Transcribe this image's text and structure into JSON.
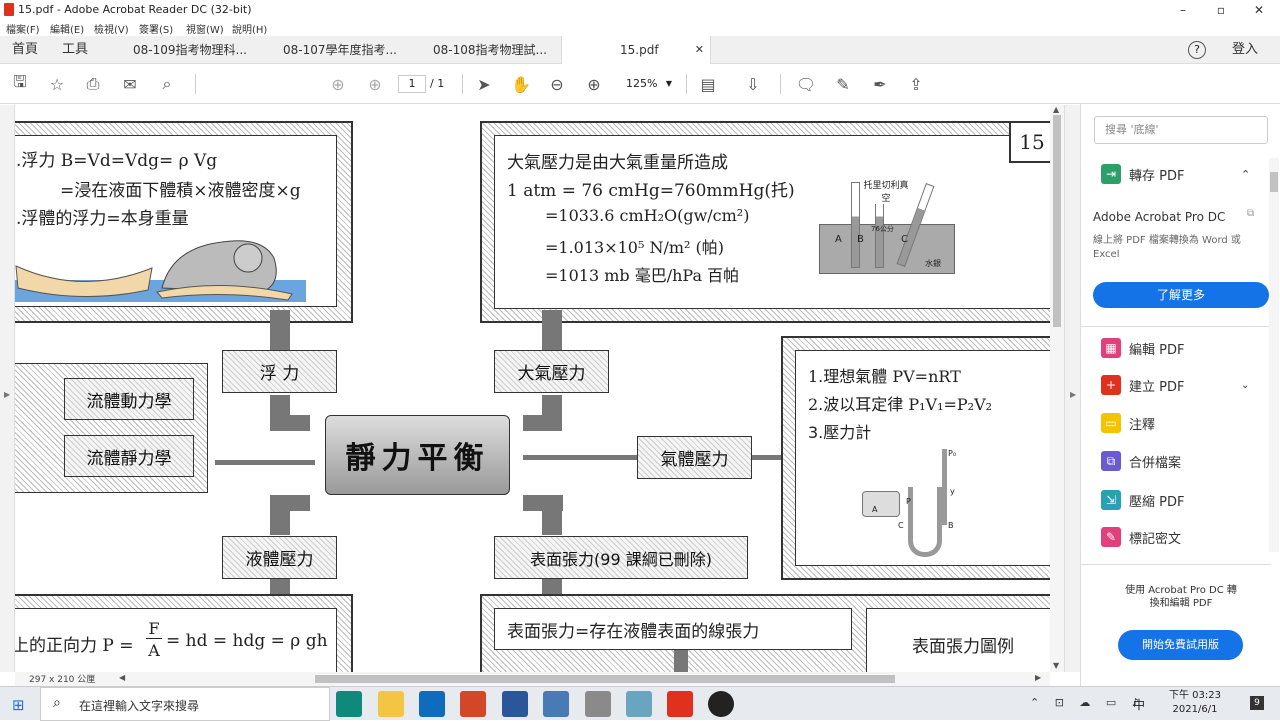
{
  "window": {
    "title": "15.pdf - Adobe Acrobat Reader DC (32-bit)",
    "min": "–",
    "max": "▫",
    "close": "✕"
  },
  "menu": [
    "檔案(F)",
    "編輯(E)",
    "檢視(V)",
    "簽署(S)",
    "視窗(W)",
    "說明(H)"
  ],
  "tabs": {
    "home": "首頁",
    "tools": "工具",
    "doc1": "08-109指考物理科...",
    "doc2": "08-107學年度指考...",
    "doc3": "08-108指考物理試...",
    "doc4": "15.pdf",
    "close": "✕",
    "help": "?",
    "login": "登入"
  },
  "toolbar": {
    "page_current": "1",
    "page_total": "/ 1",
    "zoom": "125%"
  },
  "doc": {
    "page_num": "15",
    "buoy_l1": ".浮力 B=Vd=Vdg= ρ Vg",
    "buoy_l2": "=浸在液面下體積×液體密度×g",
    "buoy_l3": ".浮體的浮力=本身重量",
    "atm_l1": "大氣壓力是由大氣重量所造成",
    "atm_l2": "1 atm = 76 cmHg=760mmHg(托)",
    "atm_l3": "=1033.6    cmH₂O(gw/cm²)",
    "atm_l4": "=1.013×10⁵    N/m² (帕)",
    "atm_l5": "=1013 mb 毫巴/hPa 百帕",
    "tube_top": "托里切利真空",
    "tube_76": "76公分",
    "tube_a": "A",
    "tube_b": "B",
    "tube_c": "C",
    "tube_hg": "水銀",
    "lbl_buoy": "浮  力",
    "lbl_atm": "大氣壓力",
    "lbl_fluid_dyn": "流體動力學",
    "lbl_fluid_stat": "流體靜力學",
    "center": "靜力平衡",
    "lbl_gas": "氣體壓力",
    "lbl_liquid": "液體壓力",
    "lbl_surface": "表面張力(99 課綱已刪除)",
    "gas_l1": "1.理想氣體 PV=nRT",
    "gas_l2": "2.波以耳定律  P₁V₁=P₂V₂",
    "gas_l3": "3.壓力計",
    "mano_p0": "P₀",
    "mano_a": "A",
    "mano_b": "B",
    "mano_c": "C",
    "mano_p": "P",
    "mano_y": "y",
    "liq_text": "上的正向力  P = F/A = hd = hdg = ρ gh",
    "liq_pre": "上的正向力  P =",
    "liq_num": "F",
    "liq_den": "A",
    "liq_post": "= hd = hdg = ρ gh",
    "surf_def": "表面張力=存在液體表面的線張力",
    "surf_fig": "表面張力圖例"
  },
  "status": {
    "size": "297 x 210 公厘"
  },
  "rightpanel": {
    "search_placeholder": "搜尋 '底線'",
    "export": "轉存 PDF",
    "pro_title": "Adobe Acrobat Pro DC",
    "pro_desc": "線上將 PDF 檔案轉換為 Word 或 Excel",
    "learn_more": "了解更多",
    "items": [
      "編輯 PDF",
      "建立 PDF",
      "注釋",
      "合併檔案",
      "壓縮 PDF",
      "標記密文"
    ],
    "promo": "使用 Acrobat Pro DC 轉換和編輯 PDF",
    "trial": "開始免費試用版"
  },
  "taskbar": {
    "search": "在這裡輸入文字來搜尋",
    "ime": "中",
    "time": "下午 03:23",
    "date": "2021/6/1",
    "notif": "9"
  },
  "colors": {
    "accent": "#1473e6",
    "pdf_red": "#e0301e"
  }
}
